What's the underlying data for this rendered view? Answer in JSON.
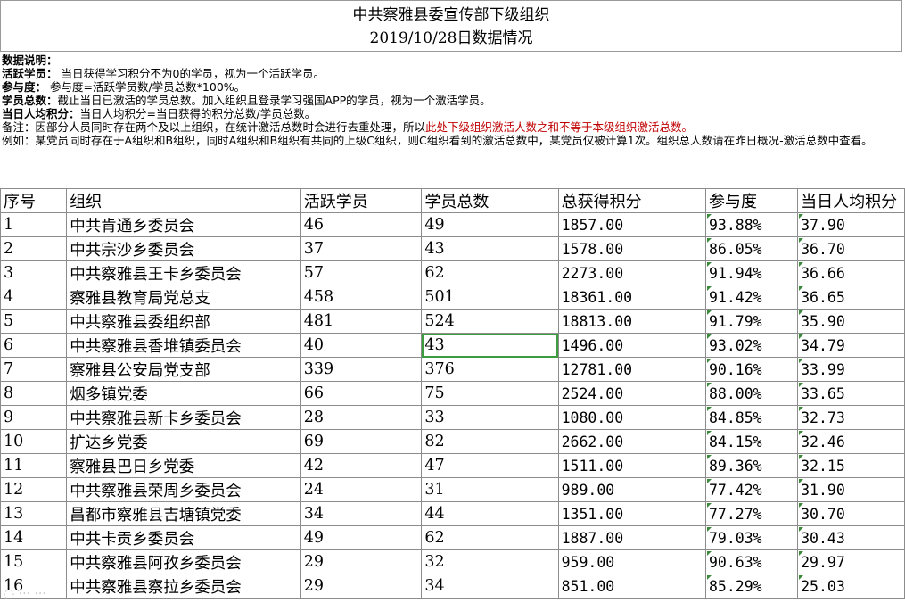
{
  "title": {
    "line1": "中共察雅县委宣传部下级组织",
    "line2": "2019/10/28日数据情况"
  },
  "notes": {
    "heading": "数据说明：",
    "active_key": "活跃学员：",
    "active_text": "当日获得学习积分不为0的学员，视为一个活跃学员。",
    "participation_key": "参与度：",
    "participation_text": "参与度=活跃学员数/学员总数*100%。",
    "total_key": "学员总数：",
    "total_text": "截止当日已激活的学员总数。加入组织且登录学习强国APP的学员，视为一个激活学员。",
    "avg_key": "当日人均积分：",
    "avg_text": "当日人均积分=当日获得的积分总数/学员总数。",
    "remark_prefix": "备注：因部分人员同时存在两个及以上组织，在统计激活总数时会进行去重处理，所以",
    "remark_red": "此处下级组织激活人数之和不等于本级组织激活总数。",
    "example": "例如：某党员同时存在于A组织和B组织，同时A组织和B组织有共同的上级C组织，则C组织看到的激活总数中，某党员仅被计算1次。组织总人数请在昨日概况-激活总数中查看。"
  },
  "table": {
    "headers": [
      "序号",
      "组织",
      "活跃学员",
      "学员总数",
      "总获得积分",
      "参与度",
      "当日人均积分"
    ],
    "rows": [
      [
        "1",
        "中共肯通乡委员会",
        "46",
        "49",
        "1857.00",
        "93.88%",
        "37.90"
      ],
      [
        "2",
        "中共宗沙乡委员会",
        "37",
        "43",
        "1578.00",
        "86.05%",
        "36.70"
      ],
      [
        "3",
        "中共察雅县王卡乡委员会",
        "57",
        "62",
        "2273.00",
        "91.94%",
        "36.66"
      ],
      [
        "4",
        "察雅县教育局党总支",
        "458",
        "501",
        "18361.00",
        "91.42%",
        "36.65"
      ],
      [
        "5",
        "中共察雅县委组织部",
        "481",
        "524",
        "18813.00",
        "91.79%",
        "35.90"
      ],
      [
        "6",
        "中共察雅县香堆镇委员会",
        "40",
        "43",
        "1496.00",
        "93.02%",
        "34.79"
      ],
      [
        "7",
        "察雅县公安局党支部",
        "339",
        "376",
        "12781.00",
        "90.16%",
        "33.99"
      ],
      [
        "8",
        "烟多镇党委",
        "66",
        "75",
        "2524.00",
        "88.00%",
        "33.65"
      ],
      [
        "9",
        "中共察雅县新卡乡委员会",
        "28",
        "33",
        "1080.00",
        "84.85%",
        "32.73"
      ],
      [
        "10",
        "扩达乡党委",
        "69",
        "82",
        "2662.00",
        "84.15%",
        "32.46"
      ],
      [
        "11",
        "察雅县巴日乡党委",
        "42",
        "47",
        "1511.00",
        "89.36%",
        "32.15"
      ],
      [
        "12",
        "中共察雅县荣周乡委员会",
        "24",
        "31",
        "989.00",
        "77.42%",
        "31.90"
      ],
      [
        "13",
        "昌都市察雅县吉塘镇党委",
        "34",
        "44",
        "1351.00",
        "77.27%",
        "30.70"
      ],
      [
        "14",
        "中共卡贡乡委员会",
        "49",
        "62",
        "1887.00",
        "79.03%",
        "30.43"
      ],
      [
        "15",
        "中共察雅县阿孜乡委员会",
        "29",
        "32",
        "959.00",
        "90.63%",
        "29.97"
      ],
      [
        "16",
        "中共察雅县察拉乡委员会",
        "29",
        "34",
        "851.00",
        "85.29%",
        "25.03"
      ]
    ]
  }
}
